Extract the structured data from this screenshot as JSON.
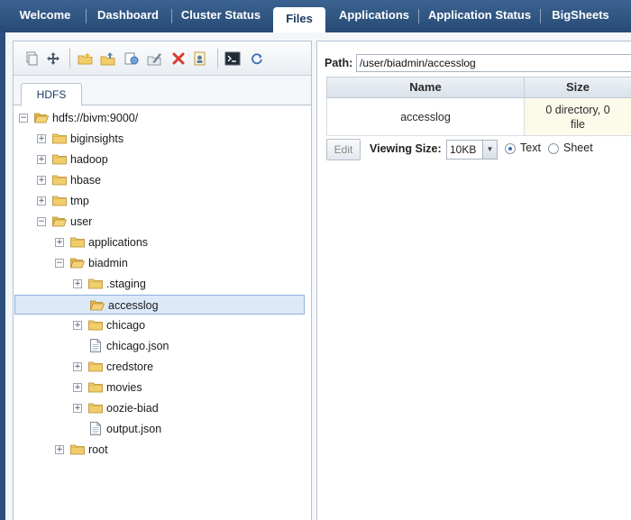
{
  "nav": {
    "tabs": [
      {
        "label": "Welcome"
      },
      {
        "label": "Dashboard"
      },
      {
        "label": "Cluster Status"
      },
      {
        "label": "Files"
      },
      {
        "label": "Applications"
      },
      {
        "label": "Application Status"
      },
      {
        "label": "BigSheets"
      }
    ],
    "active": "Files"
  },
  "toolbar": {
    "icons": [
      "copy-icon",
      "move-icon",
      "new-folder-icon",
      "upload-icon",
      "download-icon",
      "rename-icon",
      "delete-icon",
      "permissions-icon",
      "terminal-icon",
      "refresh-icon"
    ]
  },
  "left": {
    "tab_label": "HDFS",
    "tree": [
      {
        "label": "hdfs://bivm:9000/",
        "type": "folder-open",
        "expander": "−"
      },
      {
        "label": "biginsights",
        "type": "folder",
        "expander": "+"
      },
      {
        "label": "hadoop",
        "type": "folder",
        "expander": "+"
      },
      {
        "label": "hbase",
        "type": "folder",
        "expander": "+"
      },
      {
        "label": "tmp",
        "type": "folder",
        "expander": "+"
      },
      {
        "label": "user",
        "type": "folder-open",
        "expander": "−"
      },
      {
        "label": "applications",
        "type": "folder",
        "expander": "+"
      },
      {
        "label": "biadmin",
        "type": "folder-open",
        "expander": "−"
      },
      {
        "label": ".staging",
        "type": "folder",
        "expander": "+"
      },
      {
        "label": "accesslog",
        "type": "folder-open",
        "expander": ""
      },
      {
        "label": "chicago",
        "type": "folder",
        "expander": "+"
      },
      {
        "label": "chicago.json",
        "type": "file",
        "expander": ""
      },
      {
        "label": "credstore",
        "type": "folder",
        "expander": "+"
      },
      {
        "label": "movies",
        "type": "folder",
        "expander": "+"
      },
      {
        "label": "oozie-biad",
        "type": "folder",
        "expander": "+"
      },
      {
        "label": "output.json",
        "type": "file",
        "expander": ""
      },
      {
        "label": "root",
        "type": "folder",
        "expander": "+"
      }
    ],
    "selected": "accesslog"
  },
  "right": {
    "path_label": "Path:",
    "path_value": "/user/biadmin/accesslog",
    "columns": {
      "name": "Name",
      "size": "Size"
    },
    "row": {
      "name": "accesslog",
      "size_line1": "0 directory, 0",
      "size_line2": "file"
    },
    "edit_label": "Edit",
    "viewing_size_label": "Viewing Size:",
    "viewing_size_value": "10KB",
    "radio_text": "Text",
    "radio_sheet": "Sheet",
    "selected_view": "Text"
  }
}
